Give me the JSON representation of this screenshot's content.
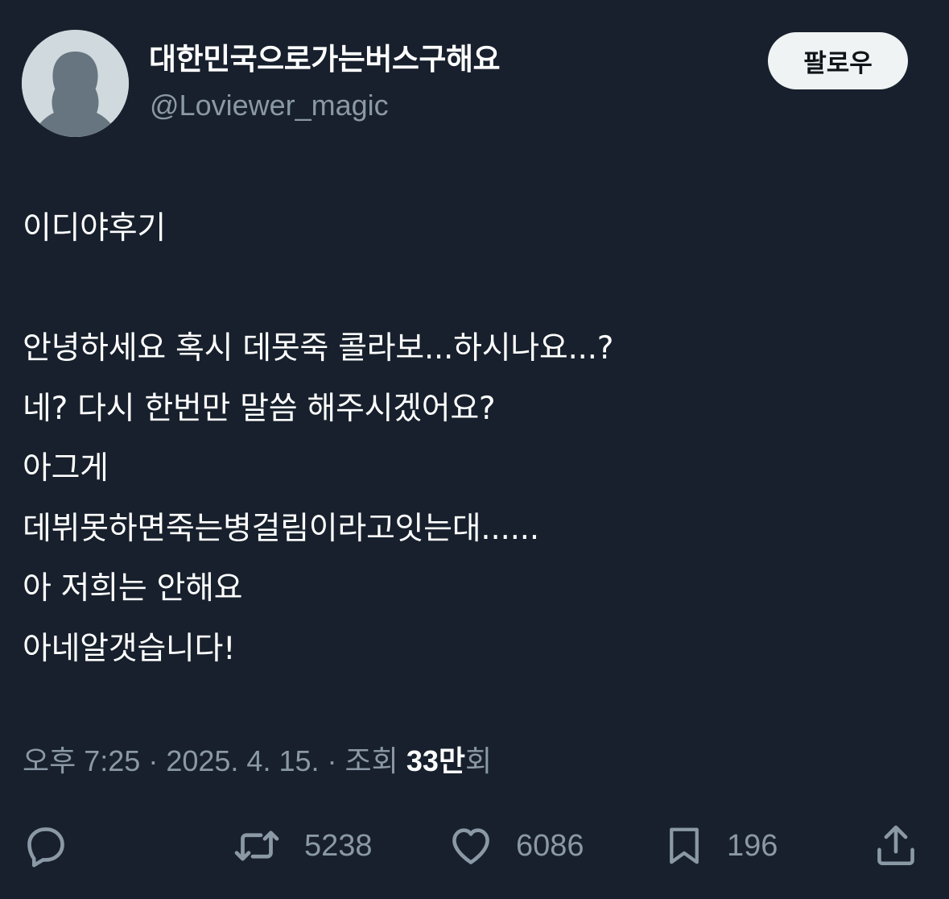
{
  "author": {
    "display_name": "대한민국으로가는버스구해요",
    "handle": "@Loviewer_magic"
  },
  "follow_button": {
    "label": "팔로우"
  },
  "tweet": {
    "lines": [
      "이디야후기",
      "",
      "안녕하세요 혹시 데못죽 콜라보...하시나요...?",
      "네? 다시 한번만 말씀 해주시겠어요?",
      "아그게",
      "데뷔못하면죽는병걸림이라고잇는대......",
      "아 저희는 안해요",
      "아네알갯습니다!"
    ]
  },
  "meta": {
    "time": "오후 7:25",
    "separator": "·",
    "date": "2025. 4. 15.",
    "views_label": "조회",
    "views_number": "33만",
    "views_suffix": "회"
  },
  "actions": {
    "reply_icon": "reply-icon",
    "retweet_icon": "retweet-icon",
    "retweet_count": "5238",
    "like_icon": "heart-icon",
    "like_count": "6086",
    "bookmark_icon": "bookmark-icon",
    "bookmark_count": "196",
    "share_icon": "share-icon"
  },
  "colors": {
    "background": "#17202c",
    "text_primary": "#ffffff",
    "text_secondary": "#8b98a5",
    "button_bg": "#eff3f4",
    "button_text": "#0f1419",
    "avatar_bg": "#cfd9de",
    "avatar_figure": "#66757f"
  }
}
